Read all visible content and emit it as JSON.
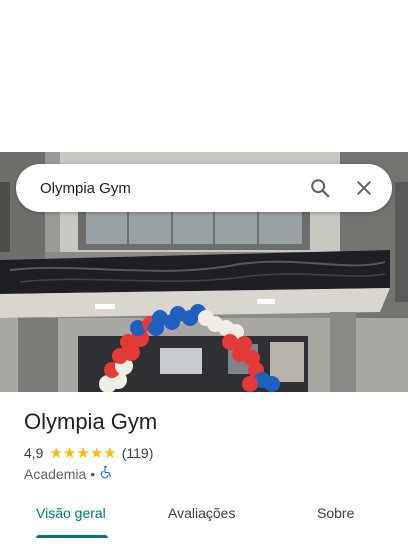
{
  "search": {
    "query": "Olympia Gym",
    "search_icon": "search-icon",
    "close_icon": "close-icon"
  },
  "place": {
    "name": "Olympia Gym",
    "rating": "4,9",
    "stars": 5,
    "review_count": "(119)",
    "category": "Academia",
    "separator": "•",
    "accessibility_icon": "wheelchair-icon"
  },
  "tabs": [
    {
      "label": "Visão geral",
      "active": true
    },
    {
      "label": "Avaliações",
      "active": false
    },
    {
      "label": "Sobre",
      "active": false
    }
  ],
  "colors": {
    "accent": "#00796b",
    "star": "#fbbc04",
    "accessibility_icon": "#1a73e8",
    "balloon_red": "#e53935",
    "balloon_blue": "#1e5fbf",
    "balloon_white": "#f1ede4"
  }
}
